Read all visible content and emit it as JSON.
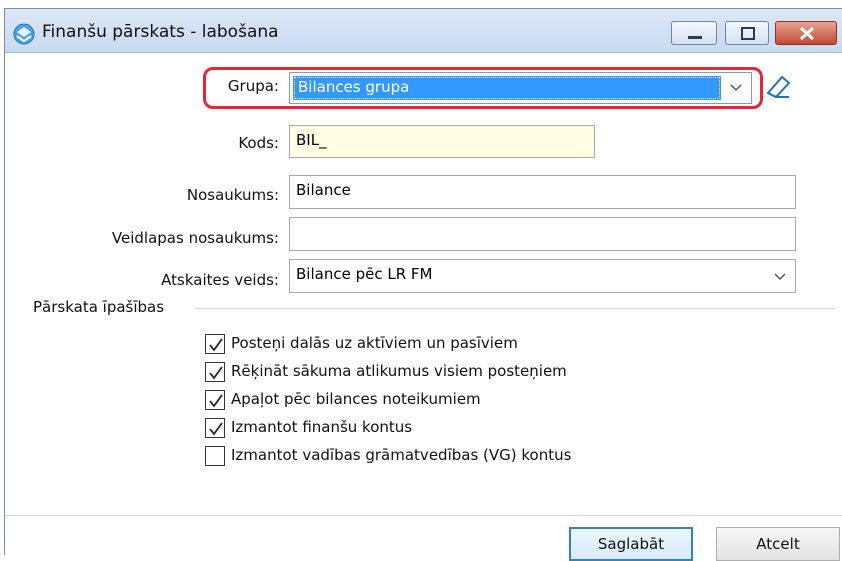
{
  "window": {
    "title": "Finanšu pārskats - labošana",
    "controls": {
      "minimize": "minimize",
      "maximize": "maximize",
      "close": "close"
    }
  },
  "form": {
    "grupa": {
      "label": "Grupa:",
      "value": "Bilances grupa"
    },
    "kods": {
      "label": "Kods:",
      "value": "BIL_"
    },
    "nosaukums": {
      "label": "Nosaukums:",
      "value": "Bilance"
    },
    "veidlapas": {
      "label": "Veidlapas nosaukums:",
      "value": ""
    },
    "atskaites": {
      "label": "Atskaites veids:",
      "value": "Bilance pēc LR FM"
    }
  },
  "properties": {
    "title": "Pārskata īpašības",
    "options": [
      {
        "label": "Posteņi dalās uz aktīviem un pasīviem",
        "checked": true
      },
      {
        "label": "Rēķināt sākuma atlikumus visiem posteņiem",
        "checked": true
      },
      {
        "label": "Apaļot pēc bilances noteikumiem",
        "checked": true
      },
      {
        "label": "Izmantot finanšu kontus",
        "checked": true
      },
      {
        "label": "Izmantot vadības grāmatvedības (VG) kontus",
        "checked": false
      }
    ]
  },
  "buttons": {
    "save": "Saglabāt",
    "cancel": "Atcelt"
  },
  "colors": {
    "highlight": "#e32636",
    "selection": "#3399ff",
    "required_bg": "#fffde3"
  }
}
